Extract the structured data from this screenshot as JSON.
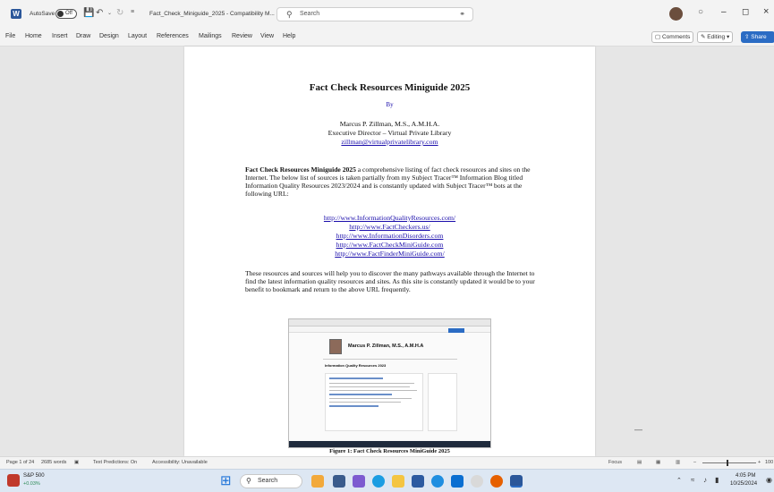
{
  "titlebar": {
    "autosave_label": "AutoSave",
    "autosave_state": "Off",
    "doc_title": "Fact_Check_Miniguide_2025 - Compatibility M...",
    "search_placeholder": "Search"
  },
  "ribbon": {
    "tabs": [
      "File",
      "Home",
      "Insert",
      "Draw",
      "Design",
      "Layout",
      "References",
      "Mailings",
      "Review",
      "View",
      "Help"
    ],
    "comments_label": "Comments",
    "editing_label": "Editing",
    "share_label": "Share"
  },
  "document": {
    "title": "Fact Check Resources Miniguide 2025",
    "by": "By",
    "author": "Marcus P. Zillman, M.S., A.M.H.A.",
    "role": "Executive Director – Virtual Private Library",
    "email": "zillman@virtualprivatelibrary.com",
    "intro_bold": "Fact Check Resources Miniguide 2025",
    "intro_rest": " a comprehensive listing of fact check resources and sites on the Internet. The below list of sources is taken partially from my Subject Tracer™ Information Blog titled Information Quality Resources 2023/2024 and is constantly updated with Subject Tracer™ bots at the following URL:",
    "links": [
      "http://www.InformationQualityResources.com/",
      "http://www.FactCheckers.us/",
      "http://www.InformationDisorders.com",
      "http://www.FactCheckMiniGuide.com",
      "http://www.FactFinderMiniGuide.com/"
    ],
    "para2": "These resources and sources will help you to discover the many pathways available through the Internet to find the latest information quality resources and sites. As this site is constantly updated it would be to your benefit to bookmark and return to the above URL frequently.",
    "embedded_heading": "Marcus P. Zillman, M.S., A.M.H.A",
    "embedded_subheading": "Information Quality Resources 2023",
    "figure_caption": "Figure 1: Fact Check Resources MiniGuide 2025"
  },
  "statusbar": {
    "page": "Page 1 of 24",
    "words": "2685 words",
    "predictions": "Text Predictions: On",
    "accessibility": "Accessibility: Unavailable",
    "focus": "Focus",
    "zoom": "100"
  },
  "taskbar": {
    "stock_name": "S&P 500",
    "stock_change": "+0.03%",
    "search": "Search",
    "time": "4:05 PM",
    "date": "10/25/2024"
  }
}
